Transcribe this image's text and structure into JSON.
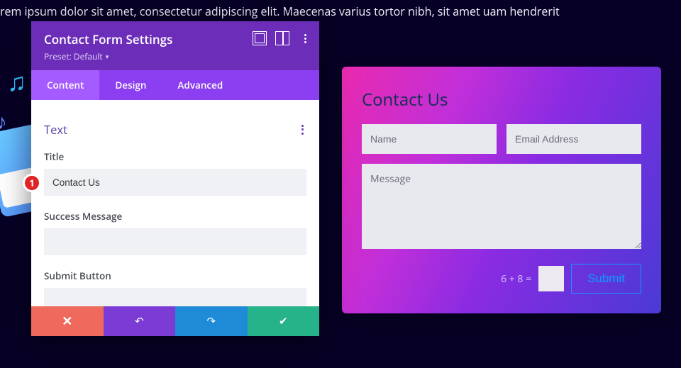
{
  "bg_text": "rem ipsum dolor sit amet, consectetur adipiscing elit. Maecenas varius tortor nibh, sit amet                                                                                                                         uam hendrerit",
  "panel": {
    "title": "Contact Form Settings",
    "preset_label": "Preset: Default",
    "tabs": {
      "content": "Content",
      "design": "Design",
      "advanced": "Advanced",
      "active": "content"
    },
    "section_title": "Text",
    "fields": {
      "title": {
        "label": "Title",
        "value": "Contact Us"
      },
      "success": {
        "label": "Success Message",
        "value": ""
      },
      "submit": {
        "label": "Submit Button",
        "value": ""
      }
    }
  },
  "callout": "1",
  "preview": {
    "heading": "Contact Us",
    "name_placeholder": "Name",
    "email_placeholder": "Email Address",
    "message_placeholder": "Message",
    "captcha_question": "6 + 8 =",
    "submit_label": "Submit"
  },
  "icons": {
    "focus": "focus-icon",
    "columns": "columns-icon",
    "more": "more-icon",
    "cancel": "×",
    "undo": "↺",
    "redo": "↻",
    "save": "✔"
  }
}
